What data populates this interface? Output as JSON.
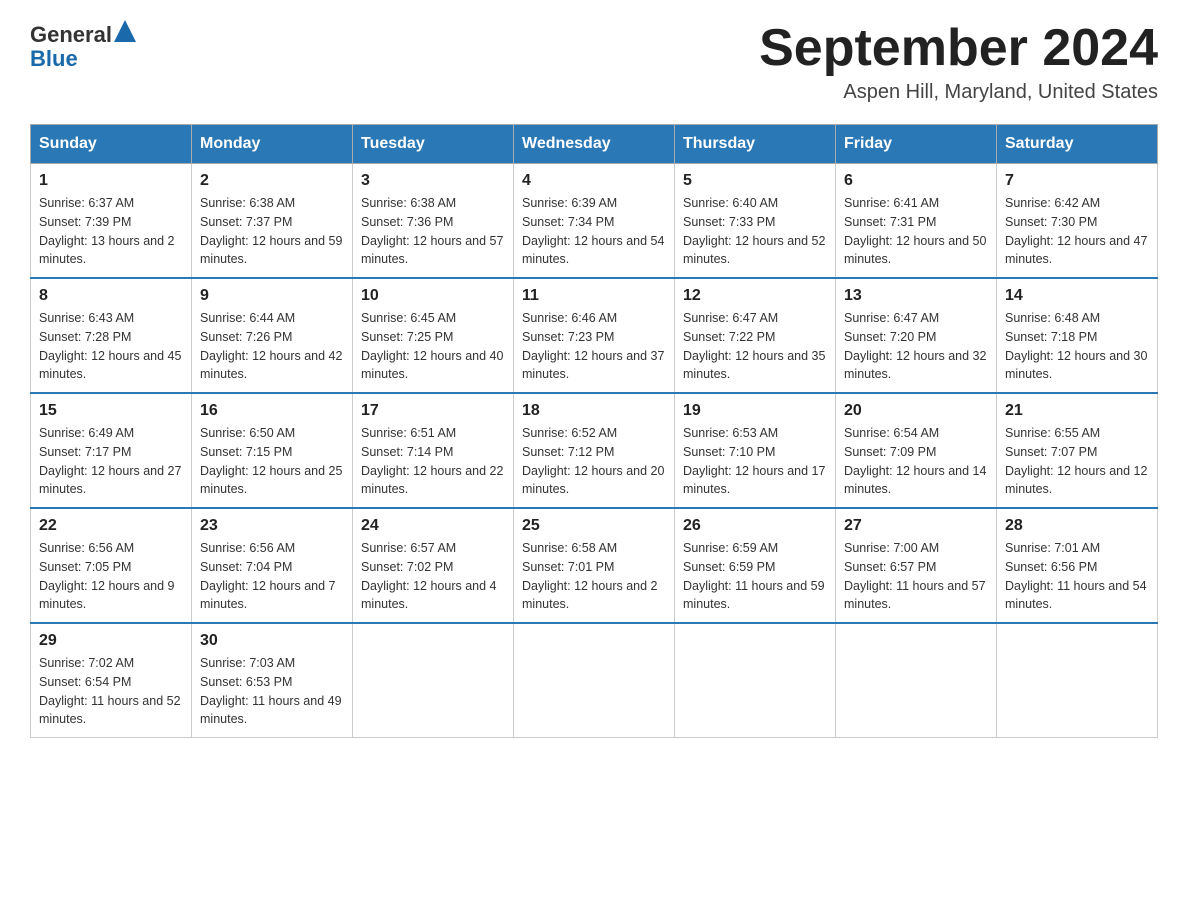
{
  "header": {
    "logo": {
      "general": "General",
      "blue": "Blue"
    },
    "title": "September 2024",
    "subtitle": "Aspen Hill, Maryland, United States"
  },
  "calendar": {
    "headers": [
      "Sunday",
      "Monday",
      "Tuesday",
      "Wednesday",
      "Thursday",
      "Friday",
      "Saturday"
    ],
    "weeks": [
      [
        {
          "day": 1,
          "sunrise": "6:37 AM",
          "sunset": "7:39 PM",
          "daylight": "13 hours and 2 minutes."
        },
        {
          "day": 2,
          "sunrise": "6:38 AM",
          "sunset": "7:37 PM",
          "daylight": "12 hours and 59 minutes."
        },
        {
          "day": 3,
          "sunrise": "6:38 AM",
          "sunset": "7:36 PM",
          "daylight": "12 hours and 57 minutes."
        },
        {
          "day": 4,
          "sunrise": "6:39 AM",
          "sunset": "7:34 PM",
          "daylight": "12 hours and 54 minutes."
        },
        {
          "day": 5,
          "sunrise": "6:40 AM",
          "sunset": "7:33 PM",
          "daylight": "12 hours and 52 minutes."
        },
        {
          "day": 6,
          "sunrise": "6:41 AM",
          "sunset": "7:31 PM",
          "daylight": "12 hours and 50 minutes."
        },
        {
          "day": 7,
          "sunrise": "6:42 AM",
          "sunset": "7:30 PM",
          "daylight": "12 hours and 47 minutes."
        }
      ],
      [
        {
          "day": 8,
          "sunrise": "6:43 AM",
          "sunset": "7:28 PM",
          "daylight": "12 hours and 45 minutes."
        },
        {
          "day": 9,
          "sunrise": "6:44 AM",
          "sunset": "7:26 PM",
          "daylight": "12 hours and 42 minutes."
        },
        {
          "day": 10,
          "sunrise": "6:45 AM",
          "sunset": "7:25 PM",
          "daylight": "12 hours and 40 minutes."
        },
        {
          "day": 11,
          "sunrise": "6:46 AM",
          "sunset": "7:23 PM",
          "daylight": "12 hours and 37 minutes."
        },
        {
          "day": 12,
          "sunrise": "6:47 AM",
          "sunset": "7:22 PM",
          "daylight": "12 hours and 35 minutes."
        },
        {
          "day": 13,
          "sunrise": "6:47 AM",
          "sunset": "7:20 PM",
          "daylight": "12 hours and 32 minutes."
        },
        {
          "day": 14,
          "sunrise": "6:48 AM",
          "sunset": "7:18 PM",
          "daylight": "12 hours and 30 minutes."
        }
      ],
      [
        {
          "day": 15,
          "sunrise": "6:49 AM",
          "sunset": "7:17 PM",
          "daylight": "12 hours and 27 minutes."
        },
        {
          "day": 16,
          "sunrise": "6:50 AM",
          "sunset": "7:15 PM",
          "daylight": "12 hours and 25 minutes."
        },
        {
          "day": 17,
          "sunrise": "6:51 AM",
          "sunset": "7:14 PM",
          "daylight": "12 hours and 22 minutes."
        },
        {
          "day": 18,
          "sunrise": "6:52 AM",
          "sunset": "7:12 PM",
          "daylight": "12 hours and 20 minutes."
        },
        {
          "day": 19,
          "sunrise": "6:53 AM",
          "sunset": "7:10 PM",
          "daylight": "12 hours and 17 minutes."
        },
        {
          "day": 20,
          "sunrise": "6:54 AM",
          "sunset": "7:09 PM",
          "daylight": "12 hours and 14 minutes."
        },
        {
          "day": 21,
          "sunrise": "6:55 AM",
          "sunset": "7:07 PM",
          "daylight": "12 hours and 12 minutes."
        }
      ],
      [
        {
          "day": 22,
          "sunrise": "6:56 AM",
          "sunset": "7:05 PM",
          "daylight": "12 hours and 9 minutes."
        },
        {
          "day": 23,
          "sunrise": "6:56 AM",
          "sunset": "7:04 PM",
          "daylight": "12 hours and 7 minutes."
        },
        {
          "day": 24,
          "sunrise": "6:57 AM",
          "sunset": "7:02 PM",
          "daylight": "12 hours and 4 minutes."
        },
        {
          "day": 25,
          "sunrise": "6:58 AM",
          "sunset": "7:01 PM",
          "daylight": "12 hours and 2 minutes."
        },
        {
          "day": 26,
          "sunrise": "6:59 AM",
          "sunset": "6:59 PM",
          "daylight": "11 hours and 59 minutes."
        },
        {
          "day": 27,
          "sunrise": "7:00 AM",
          "sunset": "6:57 PM",
          "daylight": "11 hours and 57 minutes."
        },
        {
          "day": 28,
          "sunrise": "7:01 AM",
          "sunset": "6:56 PM",
          "daylight": "11 hours and 54 minutes."
        }
      ],
      [
        {
          "day": 29,
          "sunrise": "7:02 AM",
          "sunset": "6:54 PM",
          "daylight": "11 hours and 52 minutes."
        },
        {
          "day": 30,
          "sunrise": "7:03 AM",
          "sunset": "6:53 PM",
          "daylight": "11 hours and 49 minutes."
        },
        null,
        null,
        null,
        null,
        null
      ]
    ]
  }
}
